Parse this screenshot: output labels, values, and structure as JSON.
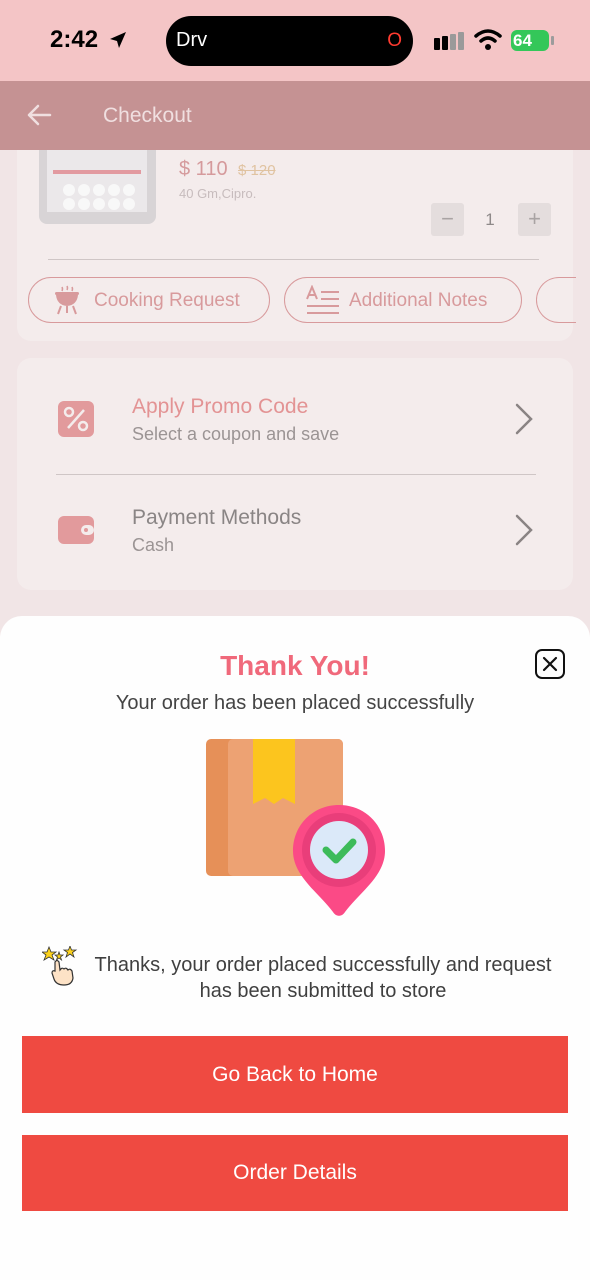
{
  "status_bar": {
    "time": "2:42",
    "activity_label": "Drv",
    "activity_indicator": "O",
    "battery": "64"
  },
  "header": {
    "title": "Checkout"
  },
  "product": {
    "price": "$ 110",
    "old_price": "$ 120",
    "subtitle": "40 Gm,Cipro.",
    "quantity": "1",
    "minus": "−",
    "plus": "+"
  },
  "actions": {
    "cooking_request": "Cooking Request",
    "additional_notes": "Additional Notes"
  },
  "promo": {
    "title": "Apply Promo Code",
    "subtitle": "Select a coupon and save"
  },
  "payment": {
    "title": "Payment Methods",
    "subtitle": "Cash"
  },
  "dialog": {
    "title": "Thank You!",
    "subtitle": "Your order has been placed successfully",
    "message": "Thanks, your order placed successfully and request has been submitted to store",
    "primary_button": "Go Back to Home",
    "secondary_button": "Order Details"
  },
  "colors": {
    "accent": "#ef4a41",
    "title_pink": "#f0697b",
    "check_green": "#3dbb5a"
  }
}
